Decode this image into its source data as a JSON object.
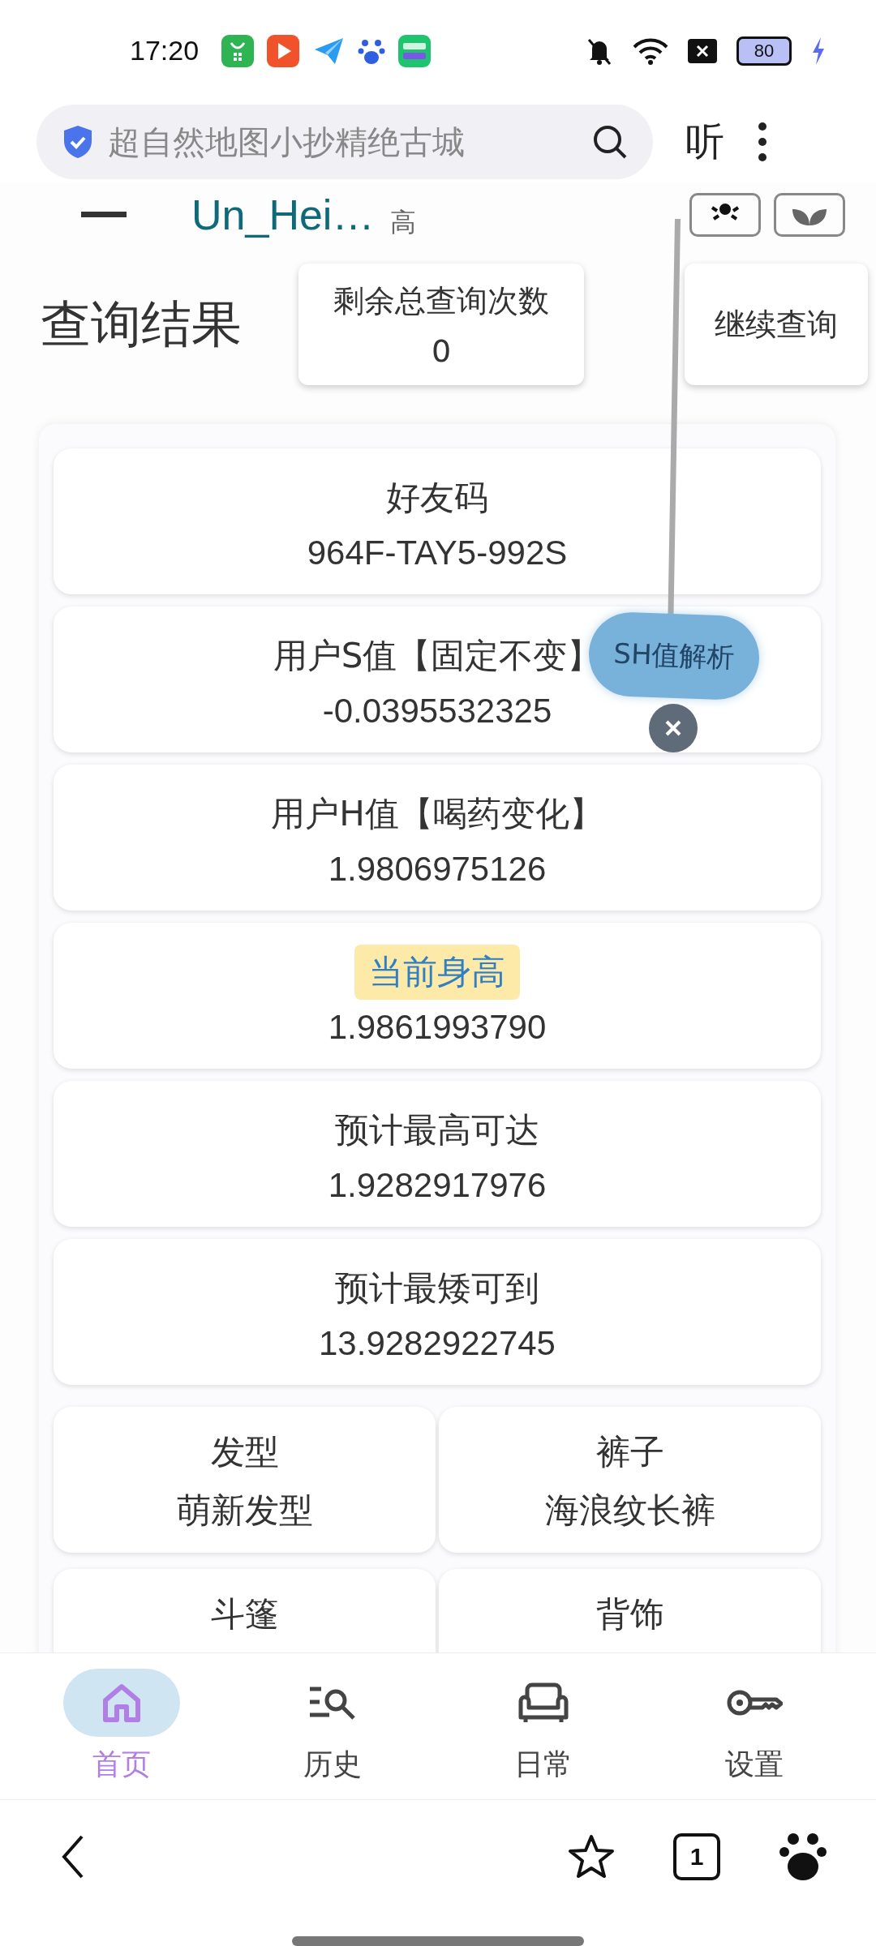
{
  "status_bar": {
    "time": "17:20",
    "battery": "80"
  },
  "address_bar": {
    "placeholder": "超自然地图小抄精绝古城",
    "listen": "听"
  },
  "header": {
    "name": "Un_Hei…",
    "tag": "高"
  },
  "result": {
    "title": "查询结果",
    "remaining_label": "剩余总查询次数",
    "remaining_value": "0",
    "continue_button": "继续查询"
  },
  "cards": [
    {
      "label": "好友码",
      "value": "964F-TAY5-992S",
      "highlighted": false
    },
    {
      "label": "用户S值【固定不变】",
      "value": "-0.0395532325",
      "highlighted": false
    },
    {
      "label": "用户H值【喝药变化】",
      "value": "1.9806975126",
      "highlighted": false
    },
    {
      "label": "当前身高",
      "value": "1.9861993790",
      "highlighted": true
    },
    {
      "label": "预计最高可达",
      "value": "1.9282917976",
      "highlighted": false
    },
    {
      "label": "预计最矮可到",
      "value": "13.9282922745",
      "highlighted": false
    }
  ],
  "outfit": [
    {
      "label": "发型",
      "value": "萌新发型"
    },
    {
      "label": "裤子",
      "value": "海浪纹长裤"
    },
    {
      "label": "斗篷"
    },
    {
      "label": "背饰"
    }
  ],
  "tooltip": {
    "label": "SH值解析"
  },
  "nav": [
    {
      "label": "首页",
      "kind": "home",
      "selected": true
    },
    {
      "label": "历史",
      "kind": "history",
      "selected": false
    },
    {
      "label": "日常",
      "kind": "daily",
      "selected": false
    },
    {
      "label": "设置",
      "kind": "settings",
      "selected": false
    }
  ],
  "browser_bar": {
    "tab_count": "1"
  }
}
